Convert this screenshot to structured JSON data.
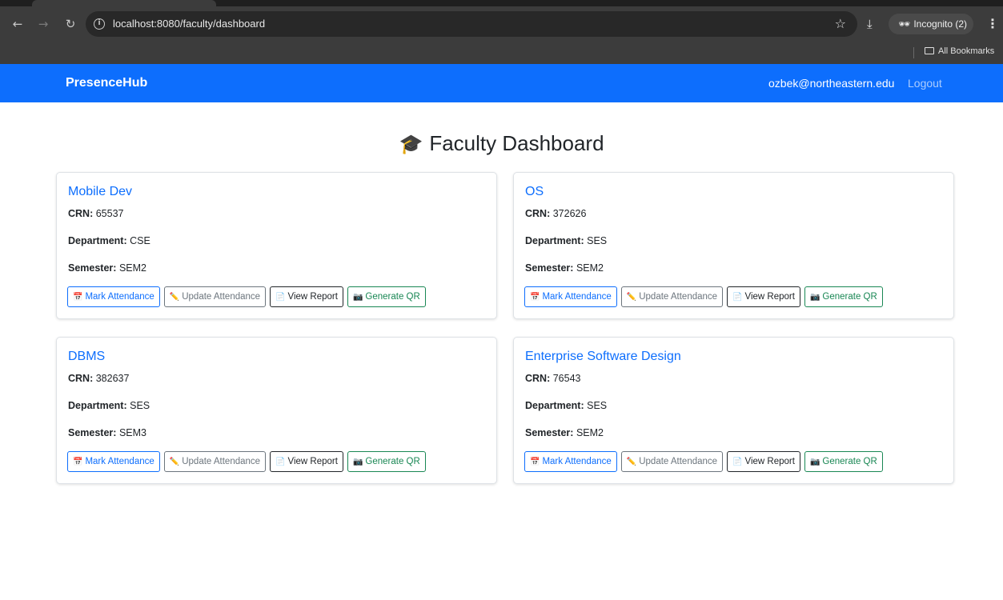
{
  "browser": {
    "url": "localhost:8080/faculty/dashboard",
    "incognito_label": "Incognito (2)",
    "bookmarks_label": "All Bookmarks"
  },
  "navbar": {
    "brand": "PresenceHub",
    "user_email": "ozbek@northeastern.edu",
    "logout": "Logout"
  },
  "page": {
    "title_icon": "🎓",
    "title": "Faculty Dashboard"
  },
  "labels": {
    "crn": "CRN:",
    "department": "Department:",
    "semester": "Semester:"
  },
  "buttons": {
    "mark": {
      "icon": "📅",
      "label": "Mark Attendance"
    },
    "update": {
      "icon": "✏️",
      "label": "Update Attendance"
    },
    "view": {
      "icon": "📄",
      "label": "View Report"
    },
    "qr": {
      "icon": "📷",
      "label": "Generate QR"
    }
  },
  "courses": [
    {
      "name": "Mobile Dev",
      "crn": "65537",
      "department": "CSE",
      "semester": "SEM2"
    },
    {
      "name": "OS",
      "crn": "372626",
      "department": "SES",
      "semester": "SEM2"
    },
    {
      "name": "DBMS",
      "crn": "382637",
      "department": "SES",
      "semester": "SEM3"
    },
    {
      "name": "Enterprise Software Design",
      "crn": "76543",
      "department": "SES",
      "semester": "SEM2"
    }
  ]
}
